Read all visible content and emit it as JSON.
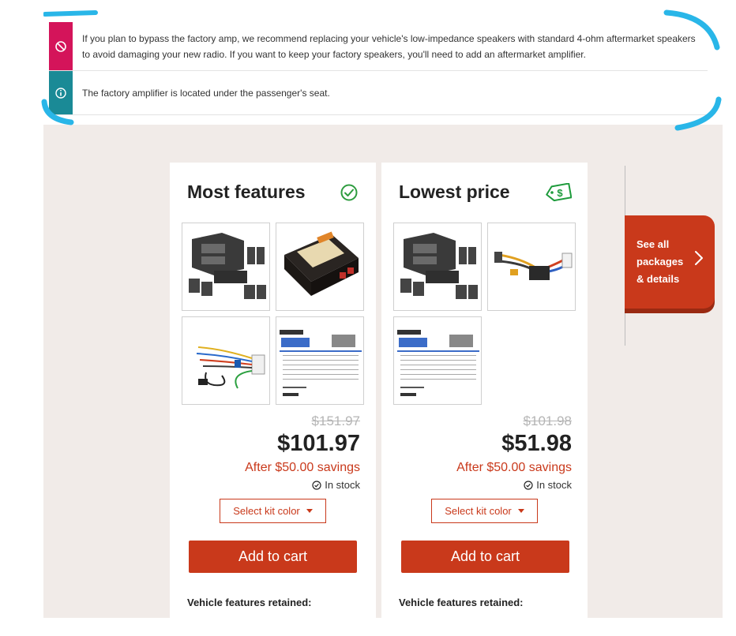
{
  "alerts": [
    {
      "type": "warning",
      "icon": "no-entry-icon",
      "text": "If you plan to bypass the factory amp, we recommend replacing your vehicle's low-impedance speakers with standard 4-ohm aftermarket speakers to avoid damaging your new radio. If you want to keep your factory speakers, you'll need to add an aftermarket amplifier."
    },
    {
      "type": "info",
      "icon": "info-icon",
      "text": "The factory amplifier is located under the passenger's seat."
    }
  ],
  "packages": [
    {
      "title": "Most features",
      "badge_icon": "check-circle-icon",
      "items": [
        "dash-kit",
        "crux-interface",
        "wiring-harness",
        "mastersheet-instructions"
      ],
      "old_price": "$151.97",
      "price": "$101.97",
      "savings": "After $50.00 savings",
      "stock": "In stock",
      "select_label": "Select kit color",
      "add_label": "Add to cart",
      "features_label": "Vehicle features retained:"
    },
    {
      "title": "Lowest price",
      "badge_icon": "price-tag-icon",
      "items": [
        "dash-kit",
        "interface-harness",
        "mastersheet-instructions"
      ],
      "old_price": "$101.98",
      "price": "$51.98",
      "savings": "After $50.00 savings",
      "stock": "In stock",
      "select_label": "Select kit color",
      "add_label": "Add to cart",
      "features_label": "Vehicle features retained:"
    }
  ],
  "see_all": {
    "label": "See all packages & details"
  },
  "colors": {
    "accent": "#c9391b",
    "warning": "#d4145a",
    "info": "#1a8a96",
    "check": "#2e9c3f",
    "tag": "#1e9b3c",
    "stage_bg": "#f1ebe8"
  }
}
